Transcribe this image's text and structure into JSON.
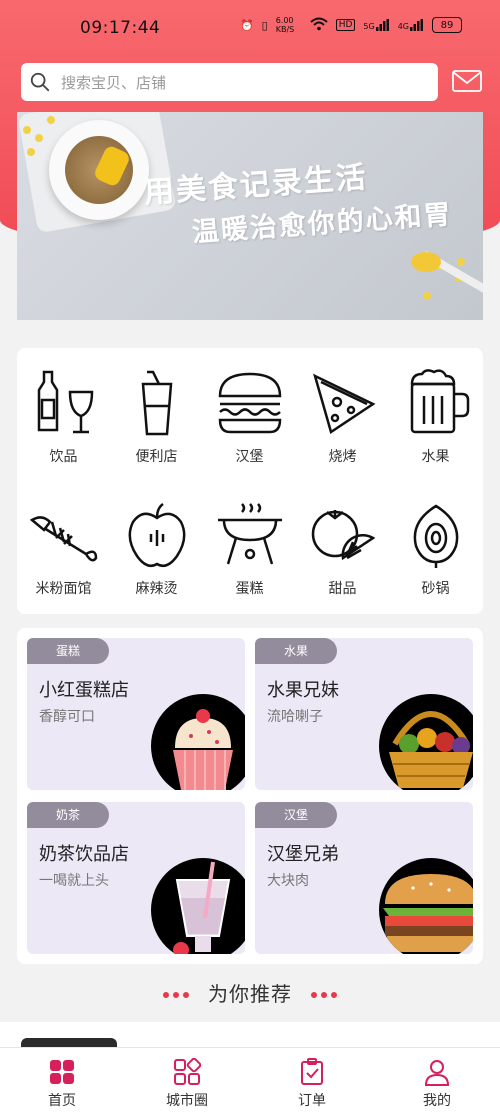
{
  "status_bar": {
    "time": "09:17:44",
    "net_speed": "6.00 KB/S",
    "hd": "HD",
    "net1": "5G",
    "net2": "4G",
    "battery": "89"
  },
  "search": {
    "placeholder": "搜索宝贝、店铺"
  },
  "banner": {
    "line1": "用美食记录生活",
    "line2": "温暖治愈你的心和胃"
  },
  "categories": [
    {
      "label": "饮品",
      "icon": "drinks-icon"
    },
    {
      "label": "便利店",
      "icon": "convenience-store-icon"
    },
    {
      "label": "汉堡",
      "icon": "burger-icon"
    },
    {
      "label": "烧烤",
      "icon": "pizza-icon"
    },
    {
      "label": "水果",
      "icon": "beer-mug-icon"
    },
    {
      "label": "米粉面馆",
      "icon": "fishbone-icon"
    },
    {
      "label": "麻辣烫",
      "icon": "apple-icon"
    },
    {
      "label": "蛋糕",
      "icon": "grill-icon"
    },
    {
      "label": "甜品",
      "icon": "tomato-lemon-icon"
    },
    {
      "label": "砂锅",
      "icon": "onion-icon"
    }
  ],
  "shops": [
    {
      "tag": "蛋糕",
      "name": "小红蛋糕店",
      "desc": "香醇可口",
      "image": "cupcake"
    },
    {
      "tag": "水果",
      "name": "水果兄妹",
      "desc": "流哈喇子",
      "image": "fruit-basket"
    },
    {
      "tag": "奶茶",
      "name": "奶茶饮品店",
      "desc": "一喝就上头",
      "image": "milk-tea"
    },
    {
      "tag": "汉堡",
      "name": "汉堡兄弟",
      "desc": "大块肉",
      "image": "hamburger"
    }
  ],
  "recommend": {
    "title": "为你推荐"
  },
  "tabbar": [
    {
      "label": "首页",
      "icon": "home-icon",
      "active": true
    },
    {
      "label": "城市圈",
      "icon": "city-circle-icon",
      "active": false
    },
    {
      "label": "订单",
      "icon": "order-icon",
      "active": false
    },
    {
      "label": "我的",
      "icon": "profile-icon",
      "active": false
    }
  ],
  "colors": {
    "brand": "#f04a55",
    "accent": "#d61f5b",
    "shop_card_bg": "#ece8f6",
    "tag_bg": "#938c9d"
  }
}
